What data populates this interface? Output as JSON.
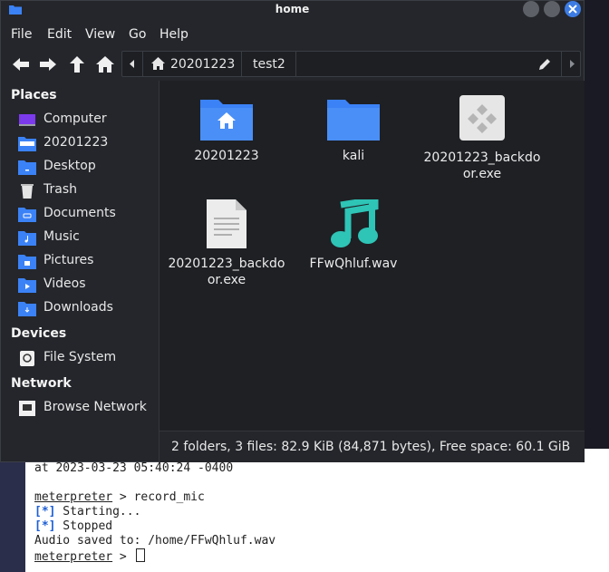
{
  "window": {
    "title": "home"
  },
  "menu": [
    "File",
    "Edit",
    "View",
    "Go",
    "Help"
  ],
  "path": {
    "segments": [
      "20201223",
      "test2"
    ]
  },
  "sidebar": {
    "places_header": "Places",
    "places": [
      {
        "label": "Computer",
        "icon": "computer-icon"
      },
      {
        "label": "20201223",
        "icon": "home-folder-icon"
      },
      {
        "label": "Desktop",
        "icon": "desktop-folder-icon"
      },
      {
        "label": "Trash",
        "icon": "trash-icon"
      },
      {
        "label": "Documents",
        "icon": "documents-folder-icon"
      },
      {
        "label": "Music",
        "icon": "music-folder-icon"
      },
      {
        "label": "Pictures",
        "icon": "pictures-folder-icon"
      },
      {
        "label": "Videos",
        "icon": "videos-folder-icon"
      },
      {
        "label": "Downloads",
        "icon": "downloads-folder-icon"
      }
    ],
    "devices_header": "Devices",
    "devices": [
      {
        "label": "File System",
        "icon": "drive-icon"
      }
    ],
    "network_header": "Network",
    "network": [
      {
        "label": "Browse Network",
        "icon": "network-icon"
      }
    ]
  },
  "files": [
    {
      "name": "20201223",
      "icon": "home-folder-icon"
    },
    {
      "name": "kali",
      "icon": "folder-icon"
    },
    {
      "name": "20201223_backdoor.exe",
      "icon": "executable-icon"
    },
    {
      "name": "20201223_backdoor.exe",
      "icon": "text-file-icon"
    },
    {
      "name": "FFwQhluf.wav",
      "icon": "audio-file-icon"
    }
  ],
  "status": "2 folders, 3 files: 82.9 KiB (84,871 bytes), Free space: 60.1 GiB",
  "terminal": {
    "line1": "at 2023-03-23 05:40:24 -0400",
    "prompt": "meterpreter",
    "command": " > record_mic",
    "starting_tag": "[*]",
    "starting": " Starting...",
    "stopped_tag": "[*]",
    "stopped": " Stopped",
    "saved": "Audio saved to: /home/FFwQhluf.wav",
    "prompt_end": " > "
  },
  "colors": {
    "accent": "#3d7ce4",
    "folder": "#3b82f6",
    "audio": "#2ec4b6"
  }
}
